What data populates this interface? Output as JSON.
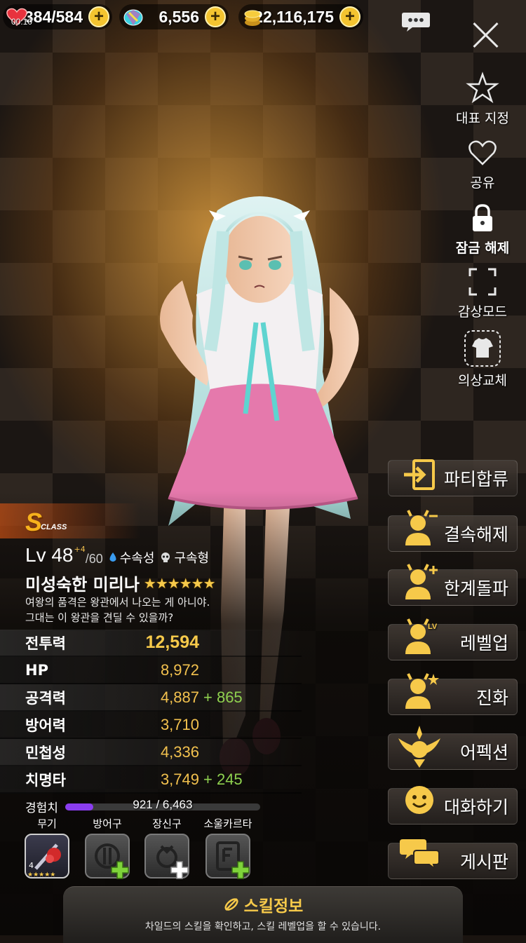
{
  "resources": {
    "stamina": {
      "value": "384/584",
      "timer": "00:10",
      "icon": "heart-icon"
    },
    "gems": {
      "value": "6,556",
      "icon": "gem-icon"
    },
    "gold": {
      "value": "22,116,175",
      "icon": "coin-icon"
    }
  },
  "side_menu": [
    {
      "label": "대표 지정",
      "icon": "star-icon"
    },
    {
      "label": "공유",
      "icon": "heart-outline-icon"
    },
    {
      "label": "잠금 해제",
      "icon": "lock-icon"
    },
    {
      "label": "감상모드",
      "icon": "fullscreen-icon"
    },
    {
      "label": "의상교체",
      "icon": "shirt-icon"
    }
  ],
  "actions": [
    {
      "label": "파티합류",
      "icon": "enter-party-icon"
    },
    {
      "label": "결속해제",
      "icon": "unbind-icon"
    },
    {
      "label": "한계돌파",
      "icon": "limit-break-icon"
    },
    {
      "label": "레벨업",
      "icon": "level-up-icon"
    },
    {
      "label": "진화",
      "icon": "evolve-icon"
    },
    {
      "label": "어펙션",
      "icon": "affection-icon"
    },
    {
      "label": "대화하기",
      "icon": "talk-icon"
    },
    {
      "label": "게시판",
      "icon": "board-icon"
    }
  ],
  "character": {
    "class": "S",
    "class_label": "CLASS",
    "level": "Lv 48",
    "level_bonus": "+4",
    "level_max": "/60",
    "element": "수속성",
    "type": "구속형",
    "name": "미성숙한 미리나",
    "stars": 6,
    "quote_line1": "여왕의 품격은 왕관에서 나오는 게 아니야.",
    "quote_line2": "그대는 이 왕관을 견딜 수 있을까?"
  },
  "stats": [
    {
      "label": "전투력",
      "value": "12,594",
      "bonus": ""
    },
    {
      "label": "HP",
      "value": "8,972",
      "bonus": ""
    },
    {
      "label": "공격력",
      "value": "4,887",
      "bonus": "+ 865"
    },
    {
      "label": "방어력",
      "value": "3,710",
      "bonus": ""
    },
    {
      "label": "민첩성",
      "value": "4,336",
      "bonus": ""
    },
    {
      "label": "치명타",
      "value": "3,749",
      "bonus": "+ 245"
    }
  ],
  "exp": {
    "label": "경험치",
    "text": "921 / 6,463",
    "fraction": 0.1425
  },
  "equipment": [
    {
      "label": "무기",
      "filled": true,
      "level": "4"
    },
    {
      "label": "방어구",
      "filled": false
    },
    {
      "label": "장신구",
      "filled": false
    },
    {
      "label": "소울카르타",
      "filled": false
    }
  ],
  "skill_panel": {
    "title": "스킬정보",
    "desc": "차일드의 스킬을 확인하고, 스킬 레벨업을 할 수 있습니다."
  },
  "colors": {
    "accent_gold": "#f6c94a",
    "bonus_green": "#8fd14f",
    "exp_purple": "#8a3df0"
  }
}
